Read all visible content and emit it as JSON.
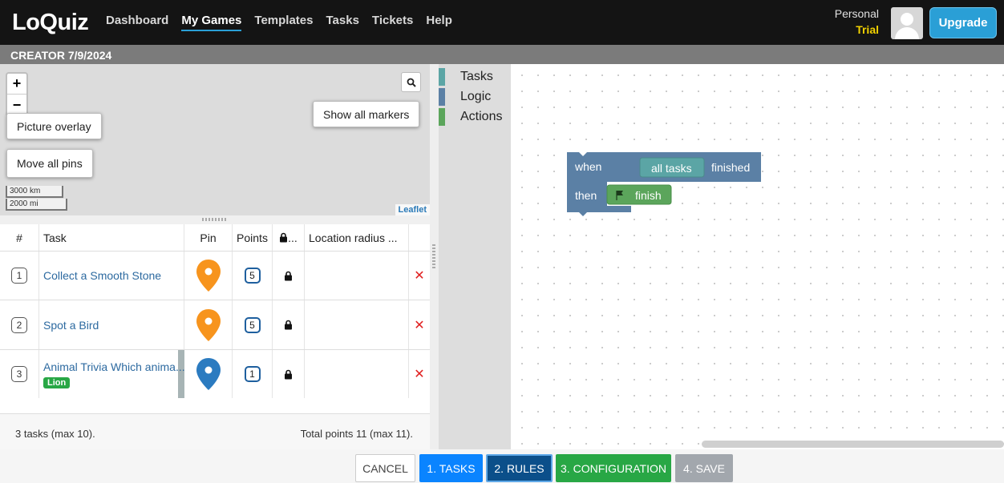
{
  "nav": {
    "logo": "LoQuiz",
    "items": [
      "Dashboard",
      "My Games",
      "Templates",
      "Tasks",
      "Tickets",
      "Help"
    ],
    "active": "My Games",
    "plan_label": "Personal",
    "plan_tier": "Trial",
    "upgrade_label": "Upgrade"
  },
  "creator": {
    "title": "CREATOR 7/9/2024"
  },
  "map": {
    "zoom_in": "+",
    "zoom_out": "−",
    "picture_overlay": "Picture overlay",
    "move_all_pins": "Move all pins",
    "show_all_markers": "Show all markers",
    "scale_km": "3000 km",
    "scale_mi": "2000 mi",
    "attribution": "Leaflet"
  },
  "table": {
    "headers": {
      "num": "#",
      "task": "Task",
      "pin": "Pin",
      "points": "Points",
      "lock": "...",
      "radius": "Location radius ..."
    },
    "rows": [
      {
        "num": "1",
        "task": "Collect a Smooth Stone",
        "points": "5",
        "pin_color": "#f7941d",
        "tag": ""
      },
      {
        "num": "2",
        "task": "Spot a Bird",
        "points": "5",
        "pin_color": "#f7941d",
        "tag": ""
      },
      {
        "num": "3",
        "task": "Animal Trivia Which anima...",
        "points": "1",
        "pin_color": "#2b7bc0",
        "tag": "Lion"
      }
    ],
    "footer_left": "3 tasks (max 10).",
    "footer_right": "Total points 11 (max 11)."
  },
  "blockly": {
    "categories": [
      {
        "label": "Tasks",
        "color": "#5ba5a5"
      },
      {
        "label": "Logic",
        "color": "#5b80a5"
      },
      {
        "label": "Actions",
        "color": "#5ba55b"
      }
    ],
    "when": "when",
    "all_tasks": "all tasks",
    "finished": "finished",
    "then": "then",
    "finish": "finish",
    "flag_icon": "flag-icon"
  },
  "steps": {
    "cancel": "CANCEL",
    "tasks": "1. TASKS",
    "rules": "2. RULES",
    "configuration": "3. CONFIGURATION",
    "save": "4. SAVE"
  }
}
